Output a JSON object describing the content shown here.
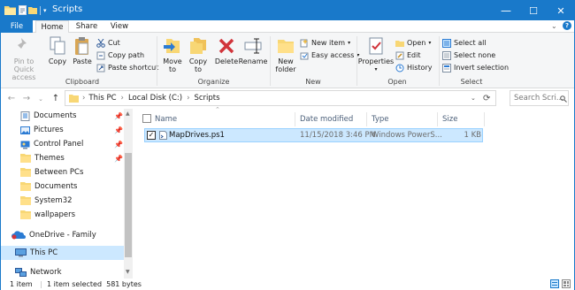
{
  "window": {
    "title": "Scripts",
    "minimize_glyph": "—",
    "maximize_glyph": "☐",
    "close_glyph": "✕"
  },
  "tabs": [
    {
      "label": "File"
    },
    {
      "label": "Home"
    },
    {
      "label": "Share"
    },
    {
      "label": "View"
    }
  ],
  "ribbon": {
    "clipboard": {
      "pin_label_1": "Pin to Quick",
      "pin_label_2": "access",
      "copy": "Copy",
      "paste": "Paste",
      "cut": "Cut",
      "copy_path": "Copy path",
      "paste_shortcut": "Paste shortcut",
      "group_label": "Clipboard"
    },
    "organize": {
      "move_to_1": "Move",
      "move_to_2": "to",
      "copy_to_1": "Copy",
      "copy_to_2": "to",
      "delete": "Delete",
      "rename": "Rename",
      "group_label": "Organize"
    },
    "new": {
      "new_folder_1": "New",
      "new_folder_2": "folder",
      "new_item": "New item",
      "easy_access": "Easy access",
      "group_label": "New"
    },
    "open": {
      "properties": "Properties",
      "open": "Open",
      "edit": "Edit",
      "history": "History",
      "group_label": "Open"
    },
    "select": {
      "select_all": "Select all",
      "select_none": "Select none",
      "invert_selection": "Invert selection",
      "group_label": "Select"
    }
  },
  "address": {
    "crumbs": [
      "This PC",
      "Local Disk (C:)",
      "Scripts"
    ],
    "separator": "›",
    "search_placeholder": "Search Scri..."
  },
  "nav_pane": {
    "items": [
      {
        "label": "Documents",
        "icon": "documents-icon",
        "pinned": true
      },
      {
        "label": "Pictures",
        "icon": "pictures-icon",
        "pinned": true
      },
      {
        "label": "Control Panel",
        "icon": "control-panel-icon",
        "pinned": true
      },
      {
        "label": "Themes",
        "icon": "folder-icon",
        "pinned": true
      },
      {
        "label": "Between PCs",
        "icon": "folder-icon",
        "pinned": false
      },
      {
        "label": "Documents",
        "icon": "folder-icon",
        "pinned": false
      },
      {
        "label": "System32",
        "icon": "folder-icon",
        "pinned": false
      },
      {
        "label": "wallpapers",
        "icon": "folder-icon",
        "pinned": false
      },
      {
        "label": "OneDrive - Family",
        "icon": "onedrive-icon",
        "pinned": false
      },
      {
        "label": "This PC",
        "icon": "this-pc-icon",
        "pinned": false
      },
      {
        "label": "Network",
        "icon": "network-icon",
        "pinned": false
      }
    ],
    "pin_glyph": "📌"
  },
  "file_list": {
    "columns": [
      "Name",
      "Date modified",
      "Type",
      "Size"
    ],
    "rows": [
      {
        "name": "MapDrives.ps1",
        "date": "11/15/2018 3:46 PM",
        "type": "Windows PowerS...",
        "size": "1 KB",
        "selected": true,
        "checked": true
      }
    ]
  },
  "status": {
    "item_count": "1 item",
    "selection": "1 item selected  581 bytes"
  },
  "colors": {
    "accent": "#1979ca",
    "selection": "#cce8ff",
    "folder": "#f8d775"
  }
}
